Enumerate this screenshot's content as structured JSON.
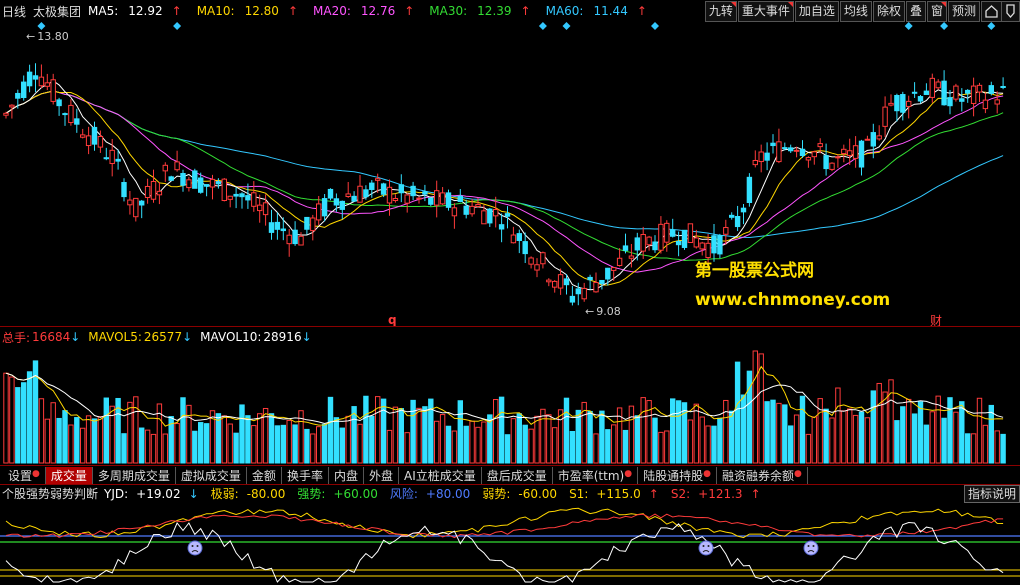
{
  "header": {
    "period": "日线",
    "stock_name": "太极集团",
    "ma": [
      {
        "label": "MA5:",
        "value": "12.92",
        "arrow": "↑",
        "color": "#ffffff",
        "arrow_color": "#ff3b3b"
      },
      {
        "label": "MA10:",
        "value": "12.80",
        "arrow": "↑",
        "color": "#ffd700",
        "arrow_color": "#ff3b3b"
      },
      {
        "label": "MA20:",
        "value": "12.76",
        "arrow": "↑",
        "color": "#ff55ff",
        "arrow_color": "#ff3b3b"
      },
      {
        "label": "MA30:",
        "value": "12.39",
        "arrow": "↑",
        "color": "#33dd33",
        "arrow_color": "#ff3b3b"
      },
      {
        "label": "MA60:",
        "value": "11.44",
        "arrow": "↑",
        "color": "#33c8ff",
        "arrow_color": "#ff3b3b"
      }
    ]
  },
  "toolbar": {
    "buttons": [
      "九转",
      "重大事件",
      "加自选",
      "均线",
      "除权",
      "叠",
      "窗",
      "预测"
    ],
    "marked": [
      true,
      true,
      false,
      false,
      false,
      false,
      true,
      false
    ]
  },
  "price_chart": {
    "high_label": "13.80",
    "low_label": "9.08",
    "marker_q": "q",
    "marker_cai": "财"
  },
  "watermark": {
    "line1": "第一股票公式网",
    "line2": "www.chnmoney.com"
  },
  "volume": {
    "total_label": "总手:",
    "total_value": "16684",
    "mavol5_label": "MAVOL5:",
    "mavol5_value": "26577",
    "mavol10_label": "MAVOL10:",
    "mavol10_value": "28916",
    "arrow_down": "↓"
  },
  "tabs": [
    {
      "label": "设置",
      "dot": true
    },
    {
      "label": "成交量",
      "dot": false,
      "active": true
    },
    {
      "label": "多周期成交量",
      "dot": false
    },
    {
      "label": "虚拟成交量",
      "dot": false
    },
    {
      "label": "金额",
      "dot": false
    },
    {
      "label": "换手率",
      "dot": false
    },
    {
      "label": "内盘",
      "dot": false
    },
    {
      "label": "外盘",
      "dot": false
    },
    {
      "label": "AI立桩成交量",
      "dot": false
    },
    {
      "label": "盘后成交量",
      "dot": false
    },
    {
      "label": "市盈率(ttm)",
      "dot": true
    },
    {
      "label": "陆股通持股",
      "dot": true
    },
    {
      "label": "融资融券余额",
      "dot": true
    }
  ],
  "indicator": {
    "name": "个股强势弱势判断",
    "items": [
      {
        "label": "YJD:",
        "value": "+19.02",
        "arrow": "↓",
        "color": "#ffffff",
        "arrow_color": "#33c8ff"
      },
      {
        "label": "极弱:",
        "value": "-80.00",
        "arrow": "",
        "color": "#ffd700"
      },
      {
        "label": "强势:",
        "value": "+60.00",
        "arrow": "",
        "color": "#33dd33"
      },
      {
        "label": "风险:",
        "value": "+80.00",
        "arrow": "",
        "color": "#4f7bff"
      },
      {
        "label": "弱势:",
        "value": "-60.00",
        "arrow": "",
        "color": "#ffd700"
      },
      {
        "label": "S1:",
        "value": "+115.0",
        "arrow": "↑",
        "color": "#ffd700",
        "arrow_color": "#ff3b3b"
      },
      {
        "label": "S2:",
        "value": "+121.3",
        "arrow": "↑",
        "color": "#ff3b3b",
        "arrow_color": "#ff3b3b"
      }
    ],
    "help_label": "指标说明"
  },
  "colors": {
    "up": "#ff3b3b",
    "down": "#33e0ff",
    "ma5": "#ffffff",
    "ma10": "#ffd700",
    "ma20": "#ff55ff",
    "ma30": "#33dd33",
    "ma60": "#33c8ff"
  }
}
